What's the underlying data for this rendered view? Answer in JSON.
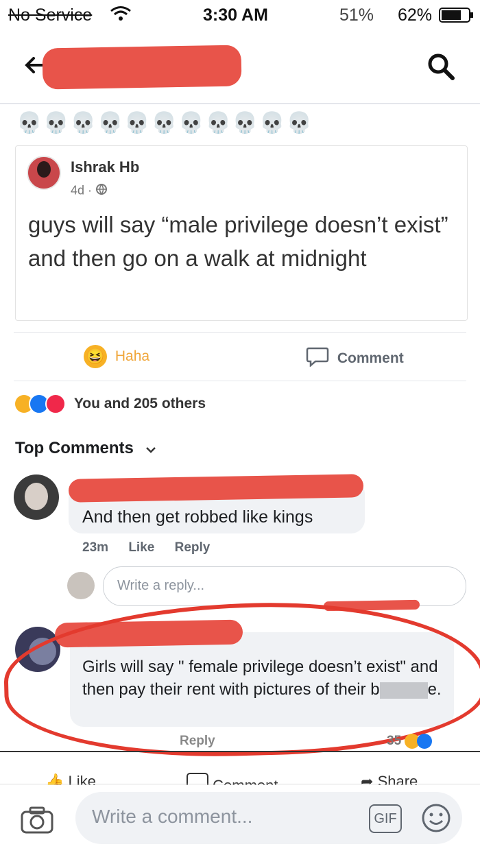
{
  "status": {
    "carrier": "No Service",
    "time": "3:30 AM",
    "battery_a": "51%",
    "battery_b": "62%"
  },
  "nav": {
    "back_icon": "arrow-left-icon",
    "search_icon": "search-icon"
  },
  "post_header": {
    "emoji_row": "💀💀💀💀💀💀💀💀💀💀💀"
  },
  "shared_post": {
    "author": "Ishrak Hb",
    "time": "4d ·",
    "text": "guys will say “male privilege doesn’t exist” and then go on a walk at midnight"
  },
  "action_row": {
    "haha_label": "Haha",
    "comment_label": "Comment"
  },
  "reactions": {
    "summary": "You and 205 others"
  },
  "comments_header": {
    "label": "Top Comments"
  },
  "comment1": {
    "text": "And then get robbed like kings",
    "time": "23m",
    "like": "Like",
    "reply": "Reply"
  },
  "reply_input": {
    "placeholder": "Write a reply..."
  },
  "comment2": {
    "text": "Girls will say \" female privilege doesn’t exist\" and then pay their rent with pictures of their b",
    "text_end": "e.",
    "reply": "Reply",
    "count": "35"
  },
  "bottom_actions": {
    "like": "Like",
    "comment": "Comment",
    "share": "Share"
  },
  "composer": {
    "placeholder": "Write a comment...",
    "gif": "GIF"
  },
  "colors": {
    "redaction": "#e8544a",
    "fb_blue": "#1877f2",
    "haha_yellow": "#f7b125"
  }
}
